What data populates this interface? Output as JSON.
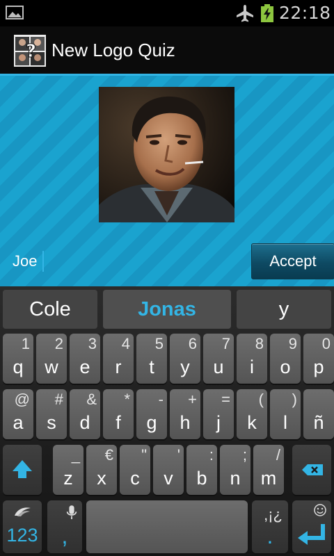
{
  "status_bar": {
    "time": "22:18",
    "icons": [
      "image-icon",
      "airplane-mode-icon",
      "battery-charging-icon"
    ],
    "battery_color": "#8dc63f"
  },
  "action_bar": {
    "title": "New Logo Quiz",
    "accent_color": "#33b5e5"
  },
  "quiz": {
    "answer_value": "Joe",
    "accept_label": "Accept",
    "background_color": "#1aa3cf"
  },
  "keyboard": {
    "suggestions": [
      "Cole",
      "Jonas",
      "y"
    ],
    "rows": [
      [
        {
          "pri": "q",
          "sec": "1"
        },
        {
          "pri": "w",
          "sec": "2"
        },
        {
          "pri": "e",
          "sec": "3"
        },
        {
          "pri": "r",
          "sec": "4"
        },
        {
          "pri": "t",
          "sec": "5"
        },
        {
          "pri": "y",
          "sec": "6"
        },
        {
          "pri": "u",
          "sec": "7"
        },
        {
          "pri": "i",
          "sec": "8"
        },
        {
          "pri": "o",
          "sec": "9"
        },
        {
          "pri": "p",
          "sec": "0"
        }
      ],
      [
        {
          "pri": "a",
          "sec": "@"
        },
        {
          "pri": "s",
          "sec": "#"
        },
        {
          "pri": "d",
          "sec": "&"
        },
        {
          "pri": "f",
          "sec": "*"
        },
        {
          "pri": "g",
          "sec": "-"
        },
        {
          "pri": "h",
          "sec": "+"
        },
        {
          "pri": "j",
          "sec": "="
        },
        {
          "pri": "k",
          "sec": "("
        },
        {
          "pri": "l",
          "sec": ")"
        },
        {
          "pri": "ñ",
          "sec": ""
        }
      ],
      [
        {
          "pri": "z",
          "sec": "_"
        },
        {
          "pri": "x",
          "sec": "€"
        },
        {
          "pri": "c",
          "sec": "\""
        },
        {
          "pri": "v",
          "sec": "'"
        },
        {
          "pri": "b",
          "sec": ":"
        },
        {
          "pri": "n",
          "sec": ";"
        },
        {
          "pri": "m",
          "sec": "/"
        }
      ]
    ],
    "numbers_label": "123",
    "comma_label": ",",
    "punct_label": ",¡¿",
    "period_label": "."
  }
}
